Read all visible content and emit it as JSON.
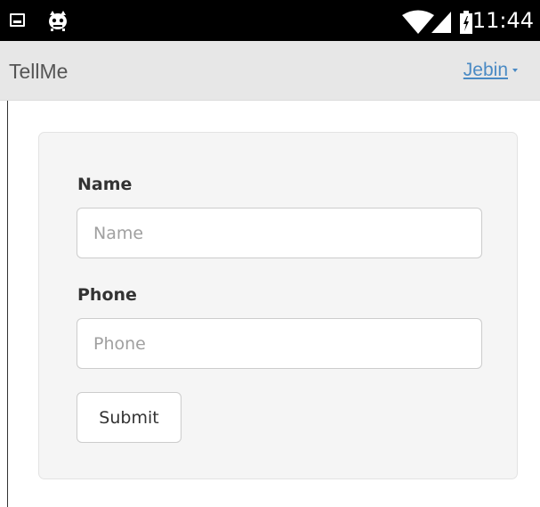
{
  "status_bar": {
    "time": "11:44",
    "icons": [
      "gallery-icon",
      "bug-icon",
      "wifi-icon",
      "signal-icon",
      "battery-icon"
    ],
    "background": "#000000"
  },
  "app_bar": {
    "brand": "TellMe",
    "user_menu": "Jebin",
    "background": "#e7e7e7",
    "link_color": "#4a8ac4"
  },
  "form": {
    "name": {
      "label": "Name",
      "placeholder": "Name",
      "value": ""
    },
    "phone": {
      "label": "Phone",
      "placeholder": "Phone",
      "value": ""
    },
    "submit_label": "Submit",
    "panel_background": "#f5f5f5"
  }
}
